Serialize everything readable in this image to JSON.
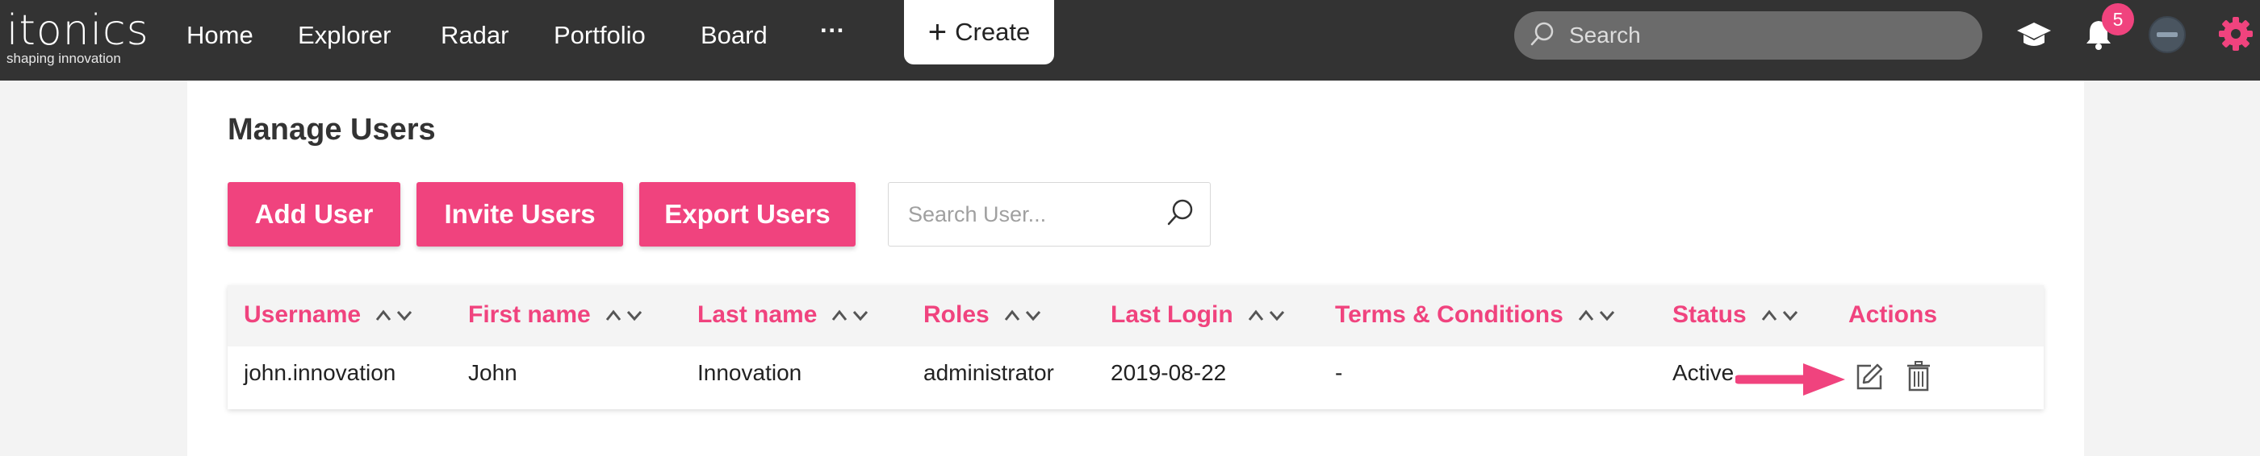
{
  "brand": {
    "name": "itonics",
    "tagline": "shaping innovation"
  },
  "nav": {
    "items": [
      "Home",
      "Explorer",
      "Radar",
      "Portfolio",
      "Board"
    ],
    "more_label": "···",
    "create_label": "Create"
  },
  "search": {
    "placeholder": "Search"
  },
  "notifications": {
    "count": "5"
  },
  "page": {
    "title": "Manage Users"
  },
  "toolbar": {
    "add_label": "Add User",
    "invite_label": "Invite Users",
    "export_label": "Export Users",
    "search_placeholder": "Search User..."
  },
  "table": {
    "columns": [
      "Username",
      "First name",
      "Last name",
      "Roles",
      "Last Login",
      "Terms & Conditions",
      "Status",
      "Actions"
    ],
    "rows": [
      {
        "username": "john.innovation",
        "first_name": "John",
        "last_name": "Innovation",
        "role": "administrator",
        "last_login": "2019-08-22",
        "terms": "-",
        "status": "Active"
      }
    ]
  },
  "colors": {
    "accent": "#f0437e",
    "topbar": "#333333",
    "annotation_arrow": "#f0437e"
  },
  "icons": [
    "search-icon",
    "graduation-cap-icon",
    "bell-icon",
    "avatar",
    "gear-icon",
    "sort-icon",
    "edit-icon",
    "trash-icon",
    "arrow-annotation"
  ]
}
